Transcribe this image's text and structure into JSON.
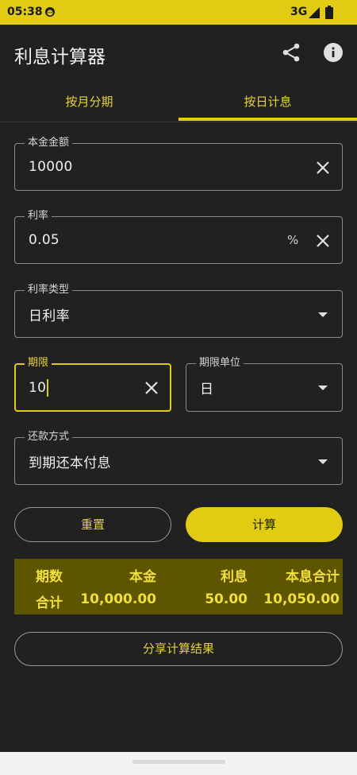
{
  "status_bar": {
    "time": "05:38",
    "network": "3G",
    "icons": [
      "face-notification-icon",
      "signal-icon",
      "battery-icon"
    ]
  },
  "app_bar": {
    "title": "利息计算器",
    "actions": [
      "share-icon",
      "info-icon"
    ]
  },
  "tabs": [
    {
      "label": "按月分期",
      "selected": false
    },
    {
      "label": "按日计息",
      "selected": true
    }
  ],
  "form": {
    "principal": {
      "label": "本金金额",
      "value": "10000"
    },
    "rate": {
      "label": "利率",
      "value": "0.05",
      "suffix": "%"
    },
    "rate_type": {
      "label": "利率类型",
      "value": "日利率"
    },
    "term": {
      "label": "期限",
      "value": "10"
    },
    "term_unit": {
      "label": "期限单位",
      "value": "日"
    },
    "repayment": {
      "label": "还款方式",
      "value": "到期还本付息"
    }
  },
  "buttons": {
    "reset": "重置",
    "calculate": "计算",
    "share_result": "分享计算结果"
  },
  "result_table": {
    "headers": [
      "期数",
      "本金",
      "利息",
      "本息合计"
    ],
    "rows": [
      [
        "合计",
        "10,000.00",
        "50.00",
        "10,050.00"
      ]
    ]
  },
  "colors": {
    "accent": "#e1cb13",
    "background": "#212121",
    "result_bg": "#5d5500"
  }
}
